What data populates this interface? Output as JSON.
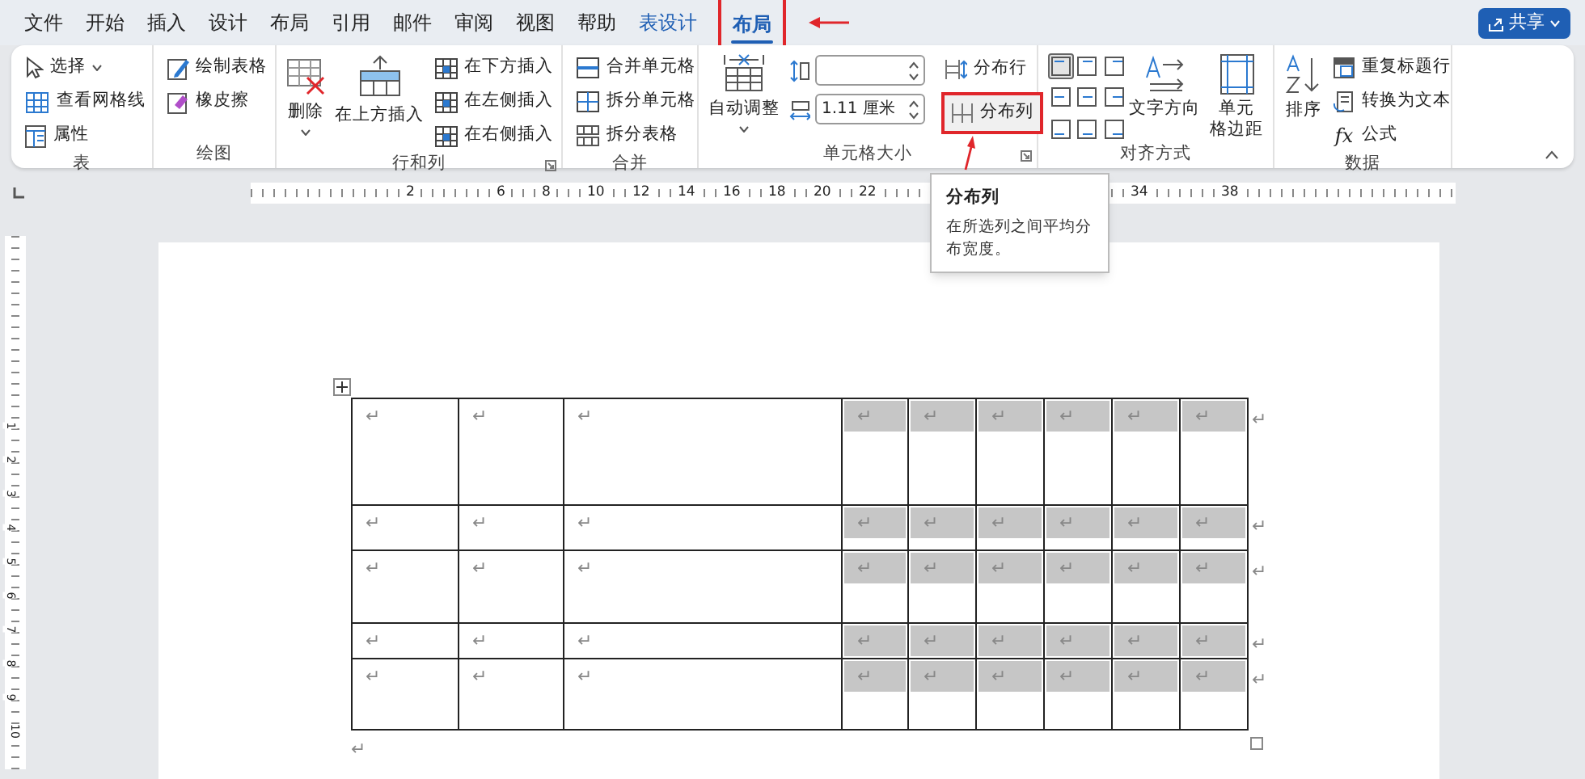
{
  "menu_tabs": [
    {
      "label": "文件",
      "selected": false,
      "kind": "plain"
    },
    {
      "label": "开始",
      "selected": false,
      "kind": "plain"
    },
    {
      "label": "插入",
      "selected": false,
      "kind": "plain"
    },
    {
      "label": "设计",
      "selected": false,
      "kind": "plain"
    },
    {
      "label": "布局",
      "selected": false,
      "kind": "plain"
    },
    {
      "label": "引用",
      "selected": false,
      "kind": "plain"
    },
    {
      "label": "邮件",
      "selected": false,
      "kind": "plain"
    },
    {
      "label": "审阅",
      "selected": false,
      "kind": "plain"
    },
    {
      "label": "视图",
      "selected": false,
      "kind": "plain"
    },
    {
      "label": "帮助",
      "selected": false,
      "kind": "plain"
    },
    {
      "label": "表设计",
      "selected": false,
      "kind": "contextual"
    },
    {
      "label": "布局",
      "selected": true,
      "kind": "contextual",
      "highlighted": true
    }
  ],
  "share_button": {
    "label": "共享"
  },
  "ribbon": {
    "table": {
      "label": "表",
      "select": "选择",
      "view_gridlines": "查看网格线",
      "properties": "属性"
    },
    "draw": {
      "label": "绘图",
      "draw_table": "绘制表格",
      "eraser": "橡皮擦"
    },
    "rows_columns": {
      "label": "行和列",
      "delete": "删除",
      "insert_above": "在上方插入",
      "insert_below": "在下方插入",
      "insert_left": "在左侧插入",
      "insert_right": "在右侧插入"
    },
    "merge": {
      "label": "合并",
      "merge_cells": "合并单元格",
      "split_cells": "拆分单元格",
      "split_table": "拆分表格"
    },
    "cell_size": {
      "label": "单元格大小",
      "autofit": "自动调整",
      "column_width": "1.11 厘米",
      "distribute_rows": "分布行",
      "distribute_columns": {
        "label": "分布列",
        "highlighted": true
      }
    },
    "alignment": {
      "label": "对齐方式",
      "buttons": [
        {
          "selected": true
        },
        {
          "selected": false
        },
        {
          "selected": false
        },
        {
          "selected": false
        },
        {
          "selected": false
        },
        {
          "selected": false
        },
        {
          "selected": false
        },
        {
          "selected": false
        },
        {
          "selected": false
        }
      ],
      "text_direction": "文字方向",
      "cell_margins": [
        "单元",
        "格边距"
      ]
    },
    "data": {
      "label": "数据",
      "sort": "排序",
      "repeat_header_rows": "重复标题行",
      "convert_to_text": "转换为文本",
      "formula_icon": "fx",
      "formula": "公式"
    }
  },
  "tooltip": {
    "title": "分布列",
    "text": "在所选列之间平均分布宽度。"
  },
  "ruler": {
    "numbers": [
      "2",
      "6",
      "8",
      "10",
      "12",
      "14",
      "16",
      "18",
      "20",
      "22",
      "34",
      "38"
    ]
  },
  "vertical_ruler": {
    "numbers": [
      "1",
      "2",
      "3",
      "4",
      "5",
      "6",
      "7",
      "8",
      "9",
      "10"
    ]
  },
  "table": {
    "rows": [
      {
        "cells": [
          {
            "text": "↵",
            "selected": false
          },
          {
            "text": "↵",
            "selected": false
          },
          {
            "text": "↵",
            "selected": false
          },
          {
            "text": "↵",
            "selected": true
          },
          {
            "text": "↵",
            "selected": true
          },
          {
            "text": "↵",
            "selected": true
          },
          {
            "text": "↵",
            "selected": true
          },
          {
            "text": "↵",
            "selected": true
          },
          {
            "text": "↵",
            "selected": true
          }
        ],
        "end_mark": "↵"
      },
      {
        "cells": [
          {
            "text": "↵",
            "selected": false
          },
          {
            "text": "↵",
            "selected": false
          },
          {
            "text": "↵",
            "selected": false
          },
          {
            "text": "↵",
            "selected": true
          },
          {
            "text": "↵",
            "selected": true
          },
          {
            "text": "↵",
            "selected": true
          },
          {
            "text": "↵",
            "selected": true
          },
          {
            "text": "↵",
            "selected": true
          },
          {
            "text": "↵",
            "selected": true
          }
        ],
        "end_mark": "↵"
      },
      {
        "cells": [
          {
            "text": "↵",
            "selected": false
          },
          {
            "text": "↵",
            "selected": false
          },
          {
            "text": "↵",
            "selected": false
          },
          {
            "text": "↵",
            "selected": true
          },
          {
            "text": "↵",
            "selected": true
          },
          {
            "text": "↵",
            "selected": true
          },
          {
            "text": "↵",
            "selected": true
          },
          {
            "text": "↵",
            "selected": true
          },
          {
            "text": "↵",
            "selected": true
          }
        ],
        "end_mark": "↵"
      },
      {
        "cells": [
          {
            "text": "↵",
            "selected": false
          },
          {
            "text": "↵",
            "selected": false
          },
          {
            "text": "↵",
            "selected": false
          },
          {
            "text": "↵",
            "selected": true
          },
          {
            "text": "↵",
            "selected": true
          },
          {
            "text": "↵",
            "selected": true
          },
          {
            "text": "↵",
            "selected": true
          },
          {
            "text": "↵",
            "selected": true
          },
          {
            "text": "↵",
            "selected": true
          }
        ],
        "end_mark": "↵"
      },
      {
        "cells": [
          {
            "text": "↵",
            "selected": false
          },
          {
            "text": "↵",
            "selected": false
          },
          {
            "text": "↵",
            "selected": false
          },
          {
            "text": "↵",
            "selected": true
          },
          {
            "text": "↵",
            "selected": true
          },
          {
            "text": "↵",
            "selected": true
          },
          {
            "text": "↵",
            "selected": true
          },
          {
            "text": "↵",
            "selected": true
          },
          {
            "text": "↵",
            "selected": true
          }
        ],
        "end_mark": "↵"
      }
    ]
  },
  "paragraph_mark": "↵"
}
